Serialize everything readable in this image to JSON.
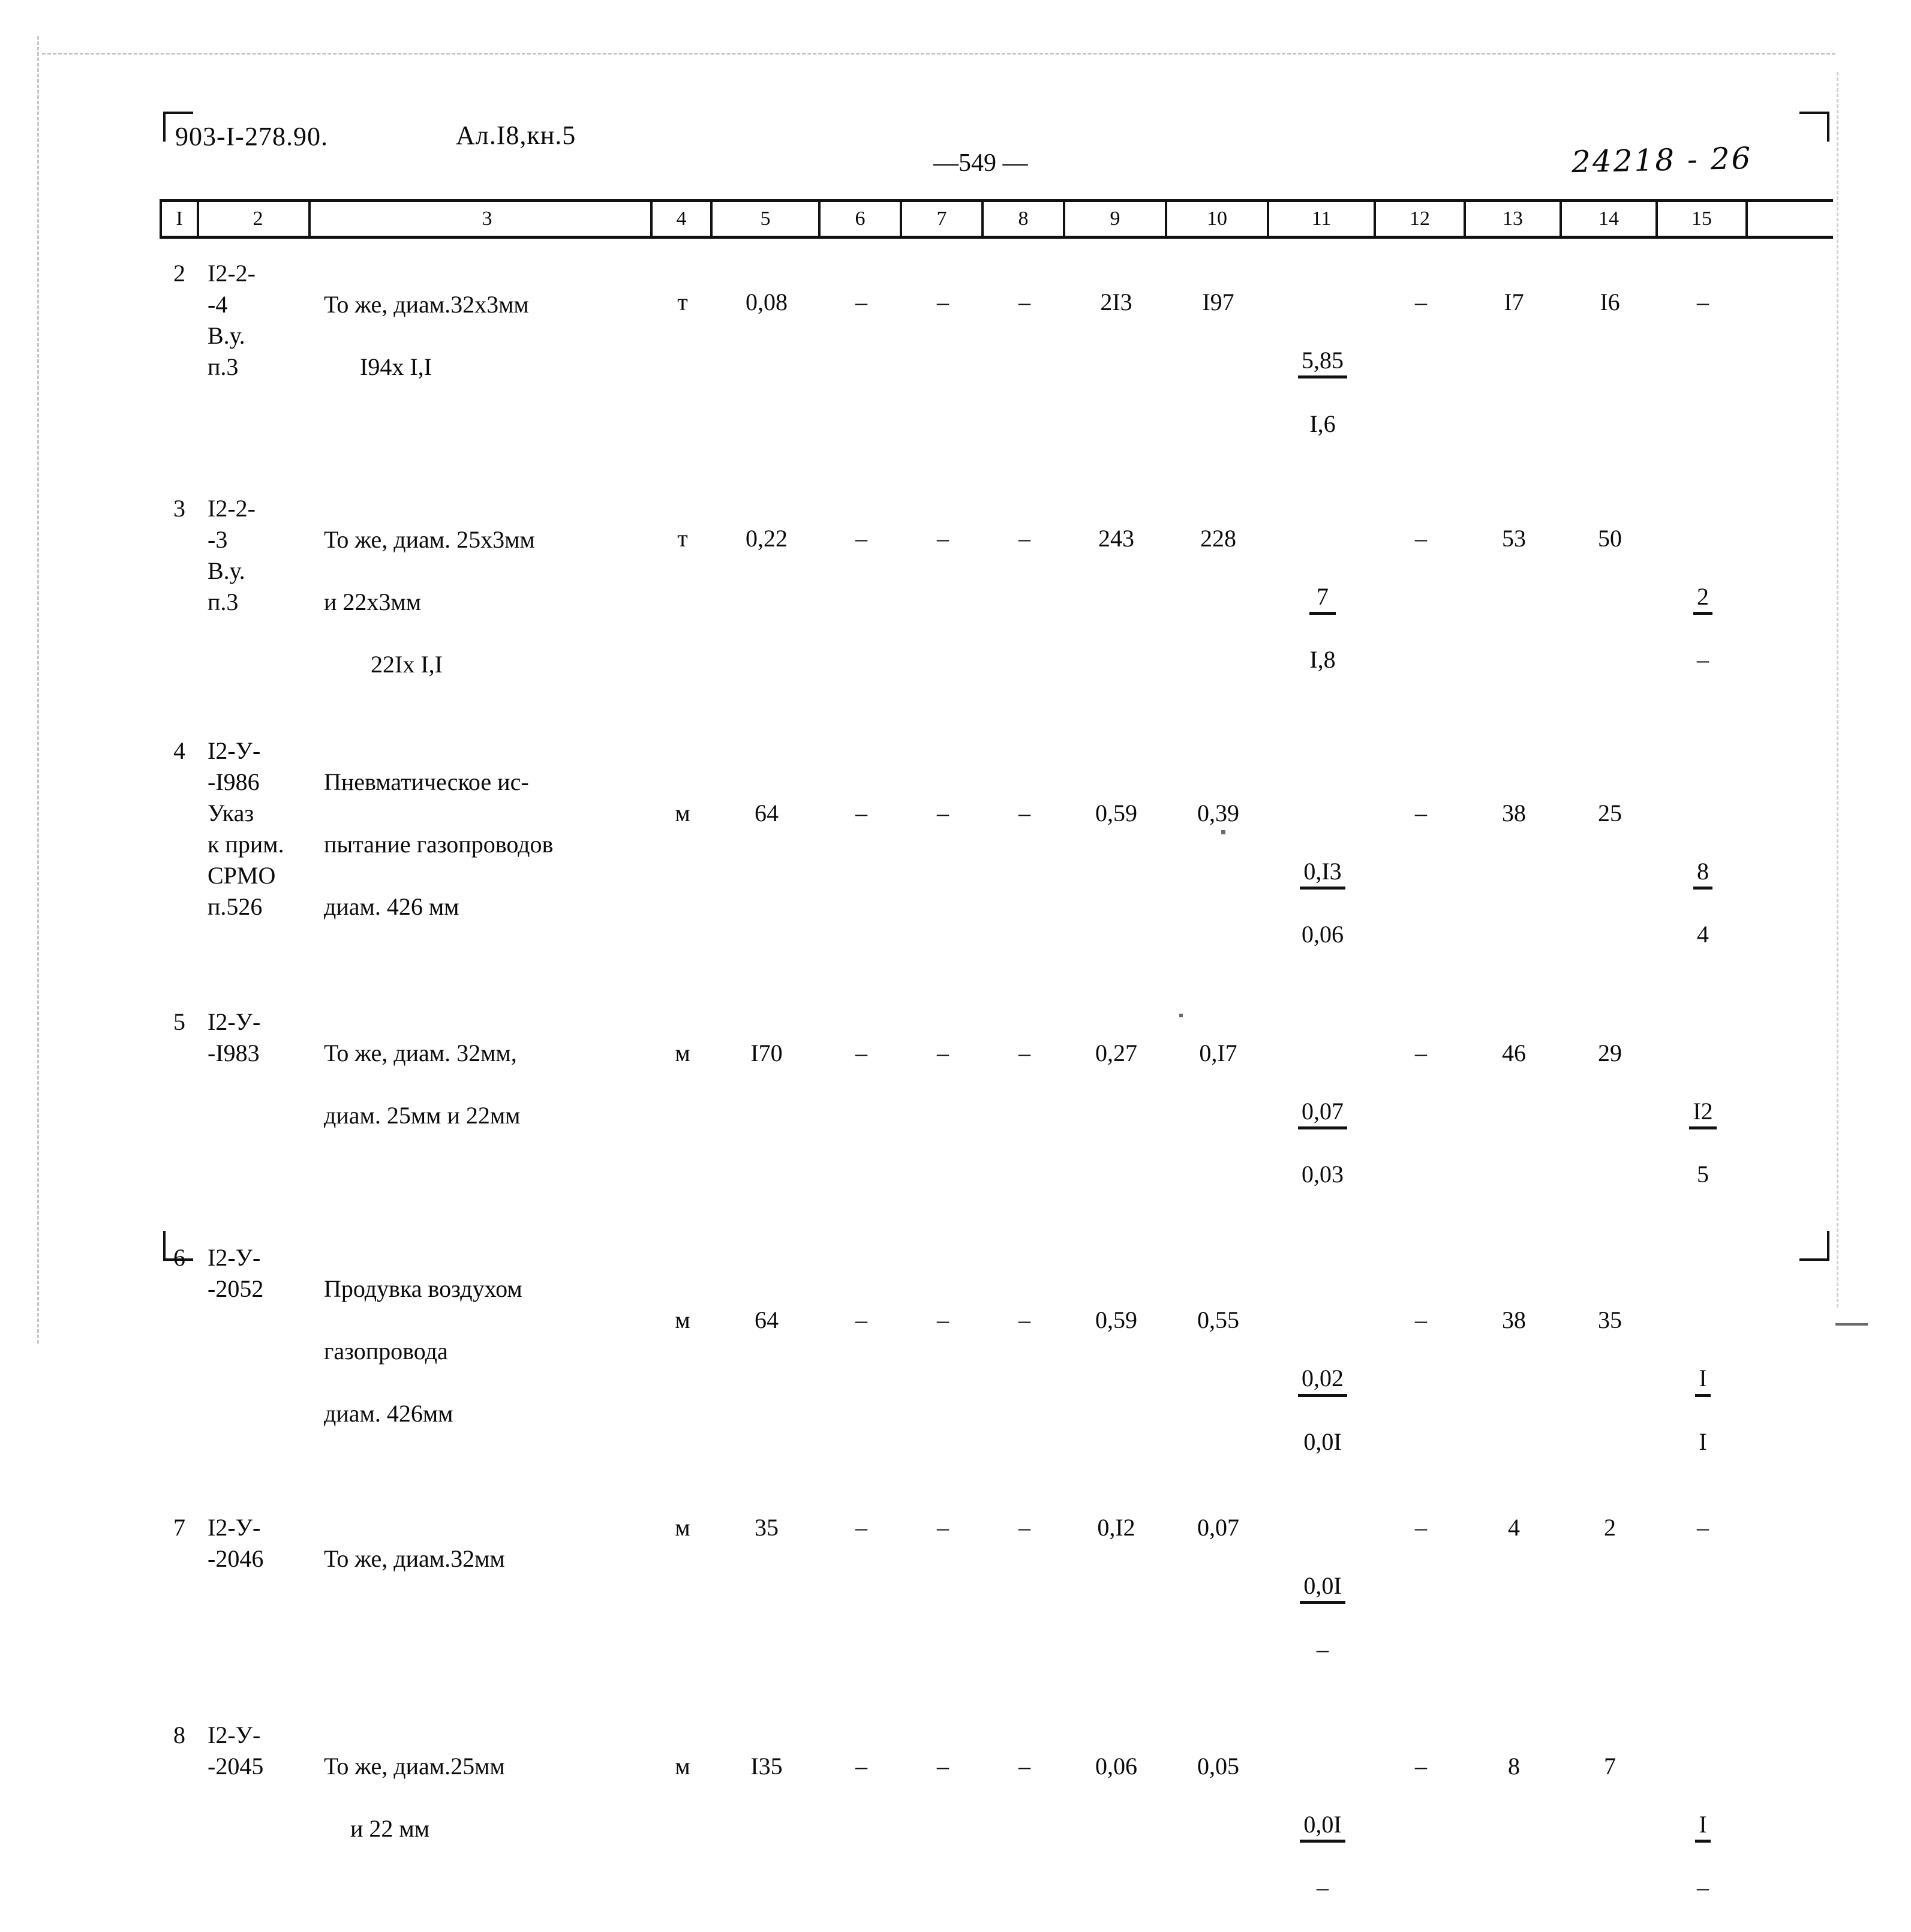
{
  "header": {
    "doc_code": "903-I-278.90.",
    "album_code": "Ал.I8,кн.5",
    "page_number": "—549 —",
    "archive_code": "24218 - 26"
  },
  "table": {
    "column_headers": [
      "I",
      "2",
      "3",
      "4",
      "5",
      "6",
      "7",
      "8",
      "9",
      "10",
      "11",
      "12",
      "13",
      "14",
      "15"
    ],
    "rows": [
      {
        "num": "2",
        "code": "I2-2-\n-4\nВ.у.\nп.3",
        "desc": "То же, диам.32х3мм",
        "desc2": "I94х I,I",
        "unit": "т",
        "qty": "0,08",
        "c6": "–",
        "c7": "–",
        "c8": "–",
        "c9": "2I3",
        "c10": "I97",
        "c11_top": "5,85",
        "c11_bot": "I,6",
        "c12": "–",
        "c13": "I7",
        "c14": "I6",
        "c15_top": "–",
        "c15_bot": ""
      },
      {
        "num": "3",
        "code": "I2-2-\n-3\nВ.у.\nп.3",
        "desc": "То же, диам. 25х3мм",
        "desc2": "и 22х3мм",
        "desc3": "22Iх I,I",
        "unit": "т",
        "qty": "0,22",
        "c6": "–",
        "c7": "–",
        "c8": "–",
        "c9": "243",
        "c10": "228",
        "c11_top": "7",
        "c11_bot": "I,8",
        "c12": "–",
        "c13": "53",
        "c14": "50",
        "c15_top": "2",
        "c15_bot": "–"
      },
      {
        "num": "4",
        "code": "I2-У-\n-I986\nУказ\nк прим.\nСРМО\nп.526",
        "desc": "Пневматическое ис-",
        "desc2": "пытание газопроводов",
        "desc3": "диам. 426 мм",
        "unit": "м",
        "qty": "64",
        "c6": "–",
        "c7": "–",
        "c8": "–",
        "c9": "0,59",
        "c10": "0,39",
        "c11_top": "0,I3",
        "c11_bot": "0,06",
        "c12": "–",
        "c13": "38",
        "c14": "25",
        "c15_top": "8",
        "c15_bot": "4"
      },
      {
        "num": "5",
        "code": "I2-У-\n-I983",
        "desc": "То же, диам. 32мм,",
        "desc2": "диам. 25мм и 22мм",
        "unit": "м",
        "qty": "I70",
        "c6": "–",
        "c7": "–",
        "c8": "–",
        "c9": "0,27",
        "c10": "0,I7",
        "c11_top": "0,07",
        "c11_bot": "0,03",
        "c12": "–",
        "c13": "46",
        "c14": "29",
        "c15_top": "I2",
        "c15_bot": "5"
      },
      {
        "num": "6",
        "code": "I2-У-\n-2052",
        "desc": "Продувка воздухом",
        "desc2": "газопровода",
        "desc3": "диам. 426мм",
        "unit": "м",
        "qty": "64",
        "c6": "–",
        "c7": "–",
        "c8": "–",
        "c9": "0,59",
        "c10": "0,55",
        "c11_top": "0,02",
        "c11_bot": "0,0I",
        "c12": "–",
        "c13": "38",
        "c14": "35",
        "c15_top": "I",
        "c15_bot": "I"
      },
      {
        "num": "7",
        "code": "I2-У-\n-2046",
        "desc": "То же, диам.32мм",
        "unit": "м",
        "qty": "35",
        "c6": "–",
        "c7": "–",
        "c8": "–",
        "c9": "0,I2",
        "c10": "0,07",
        "c11_top": "0,0I",
        "c11_bot": "–",
        "c12": "–",
        "c13": "4",
        "c14": "2",
        "c15_top": "–",
        "c15_bot": ""
      },
      {
        "num": "8",
        "code": "I2-У-\n-2045",
        "desc": "То же, диам.25мм",
        "desc2": "и 22 мм",
        "unit": "м",
        "qty": "I35",
        "c6": "–",
        "c7": "–",
        "c8": "–",
        "c9": "0,06",
        "c10": "0,05",
        "c11_top": "0,0I",
        "c11_bot": "–",
        "c12": "–",
        "c13": "8",
        "c14": "7",
        "c15_top": "I",
        "c15_bot": "–"
      }
    ]
  }
}
